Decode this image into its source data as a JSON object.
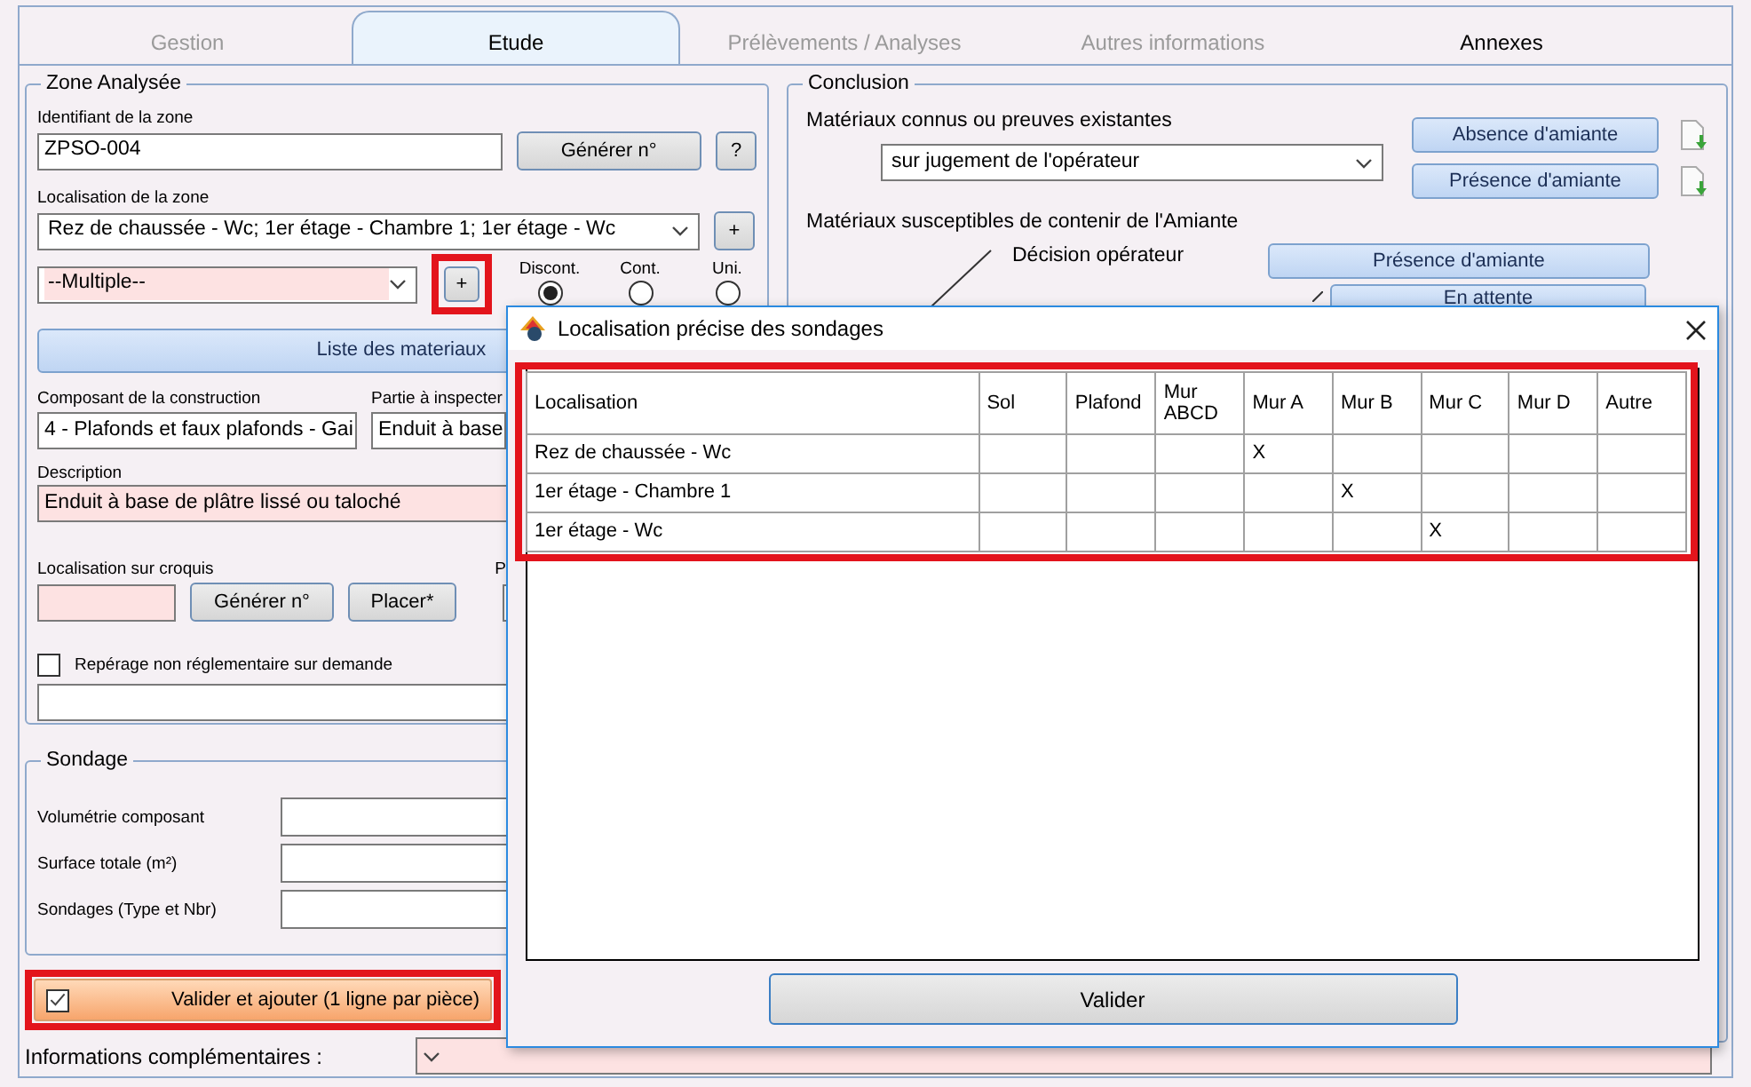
{
  "tabs": [
    {
      "label": "Gestion",
      "selected": false,
      "disabled": true
    },
    {
      "label": "Etude",
      "selected": true,
      "disabled": false
    },
    {
      "label": "Prélèvements / Analyses",
      "selected": false,
      "disabled": true
    },
    {
      "label": "Autres informations",
      "selected": false,
      "disabled": true
    },
    {
      "label": "Annexes",
      "selected": false,
      "disabled": false
    }
  ],
  "zone": {
    "title": "Zone Analysée",
    "id_label": "Identifiant de la zone",
    "id_value": "ZPSO-004",
    "generate_button": "Générer n°",
    "help_button": "?",
    "location_label": "Localisation de la zone",
    "location_value": "Rez de chaussée - Wc; 1er étage - Chambre 1; 1er étage - Wc",
    "location_add": "+",
    "multiple_value": "--Multiple--",
    "multiple_add": {
      "label": "+",
      "highlighted": true
    },
    "radios": [
      {
        "label": "Discont.",
        "selected": true
      },
      {
        "label": "Cont.",
        "selected": false
      },
      {
        "label": "Uni.",
        "selected": false
      }
    ],
    "materials_button": "Liste des materiaux",
    "component_label": "Composant de la construction",
    "component_value": "4 - Plafonds et faux plafonds - Gai",
    "part_label": "Partie à inspecter",
    "part_value": "Enduit à base",
    "description_label": "Description",
    "description_value": "Enduit à base de plâtre lissé ou taloché",
    "sketch_label": "Localisation sur croquis",
    "sketch_generate": "Générer n°",
    "sketch_place": "Placer*",
    "p_label": "P",
    "checkbox": {
      "label": "Repérage non réglementaire sur demande",
      "checked": false
    }
  },
  "sondage": {
    "title": "Sondage",
    "fields": [
      {
        "label": "Volumétrie composant"
      },
      {
        "label": "Surface totale (m²)"
      },
      {
        "label": "Sondages (Type et Nbr)"
      }
    ]
  },
  "validate_add": {
    "label": "Valider et ajouter (1 ligne par pièce)",
    "checked": true,
    "highlighted": true
  },
  "extra_label": "Informations complémentaires :",
  "conclusion": {
    "title": "Conclusion",
    "known_label": "Matériaux connus ou preuves existantes",
    "known_value": "sur jugement de l'opérateur",
    "absence_button": "Absence d'amiante",
    "presence_button": "Présence d'amiante",
    "suspect_label": "Matériaux susceptibles de contenir de l'Amiante",
    "decision_label": "Décision opérateur",
    "decision_presence": "Présence d'amiante",
    "decision_pending": "En attente"
  },
  "dialog": {
    "title": "Localisation précise des sondages",
    "highlighted": true,
    "columns": [
      "Localisation",
      "Sol",
      "Plafond",
      "Mur ABCD",
      "Mur A",
      "Mur B",
      "Mur C",
      "Mur D",
      "Autre"
    ],
    "rows": [
      {
        "cells": [
          "Rez de chaussée - Wc",
          "",
          "",
          "",
          "X",
          "",
          "",
          "",
          ""
        ]
      },
      {
        "cells": [
          "1er étage - Chambre 1",
          "",
          "",
          "",
          "",
          "X",
          "",
          "",
          ""
        ]
      },
      {
        "cells": [
          "1er étage - Wc",
          "",
          "",
          "",
          "",
          "",
          "X",
          "",
          ""
        ]
      }
    ],
    "button": "Valider"
  }
}
